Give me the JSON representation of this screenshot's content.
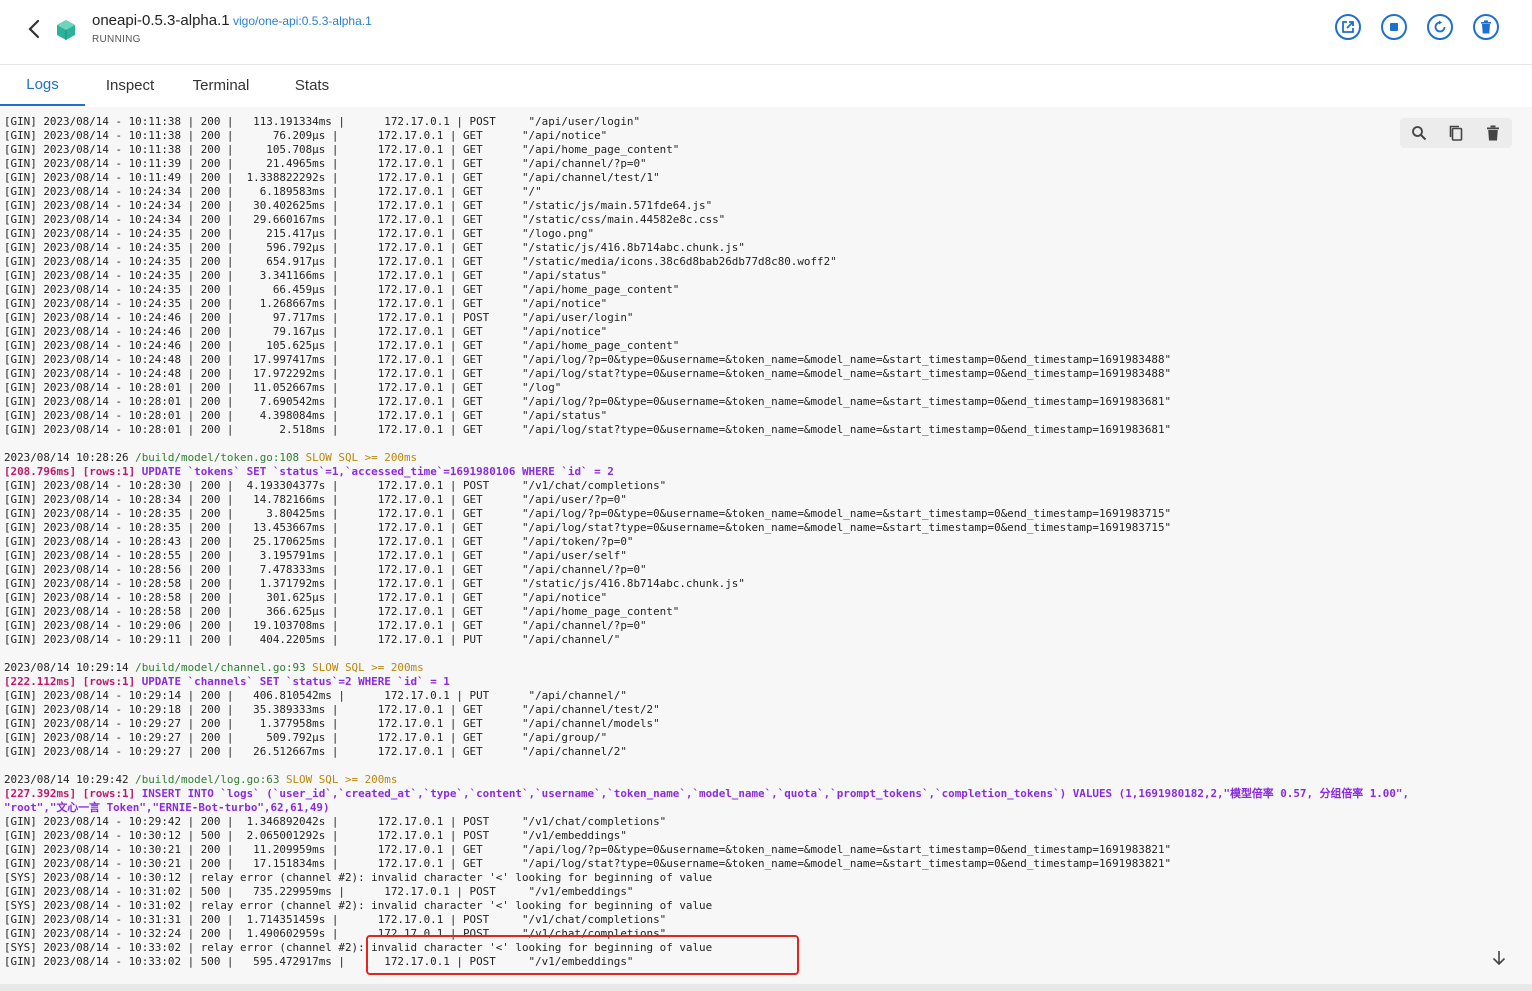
{
  "header": {
    "title": "oneapi-0.5.3-alpha.1",
    "image": "vigo/one-api:0.5.3-alpha.1",
    "status": "RUNNING",
    "accent_color": "#1e6fd0",
    "icon_color": "#2bb39a"
  },
  "tabs": [
    {
      "label": "Logs",
      "active": true
    },
    {
      "label": "Inspect",
      "active": false
    },
    {
      "label": "Terminal",
      "active": false
    },
    {
      "label": "Stats",
      "active": false
    }
  ],
  "logs": {
    "lines": [
      "[GIN] 2023/08/14 - 10:11:38 | 200 |   113.191334ms |      172.17.0.1 | POST     \"/api/user/login\"",
      "[GIN] 2023/08/14 - 10:11:38 | 200 |      76.209µs |      172.17.0.1 | GET      \"/api/notice\"",
      "[GIN] 2023/08/14 - 10:11:38 | 200 |     105.708µs |      172.17.0.1 | GET      \"/api/home_page_content\"",
      "[GIN] 2023/08/14 - 10:11:39 | 200 |     21.4965ms |      172.17.0.1 | GET      \"/api/channel/?p=0\"",
      "[GIN] 2023/08/14 - 10:11:49 | 200 |  1.338822292s |      172.17.0.1 | GET      \"/api/channel/test/1\"",
      "[GIN] 2023/08/14 - 10:24:34 | 200 |    6.189583ms |      172.17.0.1 | GET      \"/\"",
      "[GIN] 2023/08/14 - 10:24:34 | 200 |   30.402625ms |      172.17.0.1 | GET      \"/static/js/main.571fde64.js\"",
      "[GIN] 2023/08/14 - 10:24:34 | 200 |   29.660167ms |      172.17.0.1 | GET      \"/static/css/main.44582e8c.css\"",
      "[GIN] 2023/08/14 - 10:24:35 | 200 |     215.417µs |      172.17.0.1 | GET      \"/logo.png\"",
      "[GIN] 2023/08/14 - 10:24:35 | 200 |     596.792µs |      172.17.0.1 | GET      \"/static/js/416.8b714abc.chunk.js\"",
      "[GIN] 2023/08/14 - 10:24:35 | 200 |     654.917µs |      172.17.0.1 | GET      \"/static/media/icons.38c6d8bab26db77d8c80.woff2\"",
      "[GIN] 2023/08/14 - 10:24:35 | 200 |    3.341166ms |      172.17.0.1 | GET      \"/api/status\"",
      "[GIN] 2023/08/14 - 10:24:35 | 200 |      66.459µs |      172.17.0.1 | GET      \"/api/home_page_content\"",
      "[GIN] 2023/08/14 - 10:24:35 | 200 |    1.268667ms |      172.17.0.1 | GET      \"/api/notice\"",
      "[GIN] 2023/08/14 - 10:24:46 | 200 |      97.717ms |      172.17.0.1 | POST     \"/api/user/login\"",
      "[GIN] 2023/08/14 - 10:24:46 | 200 |      79.167µs |      172.17.0.1 | GET      \"/api/notice\"",
      "[GIN] 2023/08/14 - 10:24:46 | 200 |     105.625µs |      172.17.0.1 | GET      \"/api/home_page_content\"",
      "[GIN] 2023/08/14 - 10:24:48 | 200 |   17.997417ms |      172.17.0.1 | GET      \"/api/log/?p=0&type=0&username=&token_name=&model_name=&start_timestamp=0&end_timestamp=1691983488\"",
      "[GIN] 2023/08/14 - 10:24:48 | 200 |   17.972292ms |      172.17.0.1 | GET      \"/api/log/stat?type=0&username=&token_name=&model_name=&start_timestamp=0&end_timestamp=1691983488\"",
      "[GIN] 2023/08/14 - 10:28:01 | 200 |   11.052667ms |      172.17.0.1 | GET      \"/log\"",
      "[GIN] 2023/08/14 - 10:28:01 | 200 |    7.690542ms |      172.17.0.1 | GET      \"/api/log/?p=0&type=0&username=&token_name=&model_name=&start_timestamp=0&end_timestamp=1691983681\"",
      "[GIN] 2023/08/14 - 10:28:01 | 200 |    4.398084ms |      172.17.0.1 | GET      \"/api/status\"",
      "[GIN] 2023/08/14 - 10:28:01 | 200 |       2.518ms |      172.17.0.1 | GET      \"/api/log/stat?type=0&username=&token_name=&model_name=&start_timestamp=0&end_timestamp=1691983681\"",
      "",
      "2023/08/14 10:28:26 /build/model/token.go:108 SLOW SQL >= 200ms",
      "[208.796ms] [rows:1] UPDATE `tokens` SET `status`=1,`accessed_time`=1691980106 WHERE `id` = 2",
      "[GIN] 2023/08/14 - 10:28:30 | 200 |  4.193304377s |      172.17.0.1 | POST     \"/v1/chat/completions\"",
      "[GIN] 2023/08/14 - 10:28:34 | 200 |   14.782166ms |      172.17.0.1 | GET      \"/api/user/?p=0\"",
      "[GIN] 2023/08/14 - 10:28:35 | 200 |     3.80425ms |      172.17.0.1 | GET      \"/api/log/?p=0&type=0&username=&token_name=&model_name=&start_timestamp=0&end_timestamp=1691983715\"",
      "[GIN] 2023/08/14 - 10:28:35 | 200 |   13.453667ms |      172.17.0.1 | GET      \"/api/log/stat?type=0&username=&token_name=&model_name=&start_timestamp=0&end_timestamp=1691983715\"",
      "[GIN] 2023/08/14 - 10:28:43 | 200 |   25.170625ms |      172.17.0.1 | GET      \"/api/token/?p=0\"",
      "[GIN] 2023/08/14 - 10:28:55 | 200 |    3.195791ms |      172.17.0.1 | GET      \"/api/user/self\"",
      "[GIN] 2023/08/14 - 10:28:56 | 200 |    7.478333ms |      172.17.0.1 | GET      \"/api/channel/?p=0\"",
      "[GIN] 2023/08/14 - 10:28:58 | 200 |    1.371792ms |      172.17.0.1 | GET      \"/static/js/416.8b714abc.chunk.js\"",
      "[GIN] 2023/08/14 - 10:28:58 | 200 |     301.625µs |      172.17.0.1 | GET      \"/api/notice\"",
      "[GIN] 2023/08/14 - 10:28:58 | 200 |     366.625µs |      172.17.0.1 | GET      \"/api/home_page_content\"",
      "[GIN] 2023/08/14 - 10:29:06 | 200 |   19.103708ms |      172.17.0.1 | GET      \"/api/channel/?p=0\"",
      "[GIN] 2023/08/14 - 10:29:11 | 200 |    404.2205ms |      172.17.0.1 | PUT      \"/api/channel/\"",
      "",
      "2023/08/14 10:29:14 /build/model/channel.go:93 SLOW SQL >= 200ms",
      "[222.112ms] [rows:1] UPDATE `channels` SET `status`=2 WHERE `id` = 1",
      "[GIN] 2023/08/14 - 10:29:14 | 200 |   406.810542ms |      172.17.0.1 | PUT      \"/api/channel/\"",
      "[GIN] 2023/08/14 - 10:29:18 | 200 |   35.389333ms |      172.17.0.1 | GET      \"/api/channel/test/2\"",
      "[GIN] 2023/08/14 - 10:29:27 | 200 |    1.377958ms |      172.17.0.1 | GET      \"/api/channel/models\"",
      "[GIN] 2023/08/14 - 10:29:27 | 200 |     509.792µs |      172.17.0.1 | GET      \"/api/group/\"",
      "[GIN] 2023/08/14 - 10:29:27 | 200 |   26.512667ms |      172.17.0.1 | GET      \"/api/channel/2\"",
      "",
      "2023/08/14 10:29:42 /build/model/log.go:63 SLOW SQL >= 200ms",
      "[227.392ms] [rows:1] INSERT INTO `logs` (`user_id`,`created_at`,`type`,`content`,`username`,`token_name`,`model_name`,`quota`,`prompt_tokens`,`completion_tokens`) VALUES (1,1691980182,2,\"模型倍率 0.57, 分组倍率 1.00\",",
      "\"root\",\"文心一言 Token\",\"ERNIE-Bot-turbo\",62,61,49)",
      "[GIN] 2023/08/14 - 10:29:42 | 200 |  1.346892042s |      172.17.0.1 | POST     \"/v1/chat/completions\"",
      "[GIN] 2023/08/14 - 10:30:12 | 500 |  2.065001292s |      172.17.0.1 | POST     \"/v1/embeddings\"",
      "[GIN] 2023/08/14 - 10:30:21 | 200 |   11.209959ms |      172.17.0.1 | GET      \"/api/log/?p=0&type=0&username=&token_name=&model_name=&start_timestamp=0&end_timestamp=1691983821\"",
      "[GIN] 2023/08/14 - 10:30:21 | 200 |   17.151834ms |      172.17.0.1 | GET      \"/api/log/stat?type=0&username=&token_name=&model_name=&start_timestamp=0&end_timestamp=1691983821\"",
      "[SYS] 2023/08/14 - 10:30:12 | relay error (channel #2): invalid character '<' looking for beginning of value",
      "[GIN] 2023/08/14 - 10:31:02 | 500 |   735.229959ms |      172.17.0.1 | POST     \"/v1/embeddings\"",
      "[SYS] 2023/08/14 - 10:31:02 | relay error (channel #2): invalid character '<' looking for beginning of value",
      "[GIN] 2023/08/14 - 10:31:31 | 200 |  1.714351459s |      172.17.0.1 | POST     \"/v1/chat/completions\"",
      "[GIN] 2023/08/14 - 10:32:24 | 200 |  1.490602959s |      172.17.0.1 | POST     \"/v1/chat/completions\"",
      "[SYS] 2023/08/14 - 10:33:02 | relay error (channel #2): invalid character '<' looking for beginning of value",
      "[GIN] 2023/08/14 - 10:33:02 | 500 |   595.472917ms |      172.17.0.1 | POST     \"/v1/embeddings\""
    ]
  },
  "toolbar": {
    "icons": [
      "search-icon",
      "copy-icon",
      "trash-icon"
    ]
  },
  "highlight_color": "#e0261f"
}
